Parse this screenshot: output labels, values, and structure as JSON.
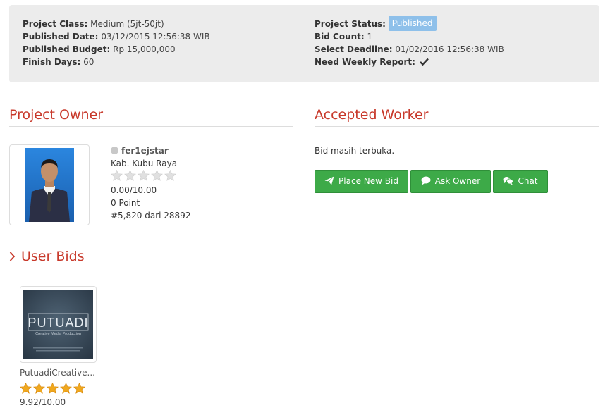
{
  "project_info": {
    "left": [
      {
        "label": "Project Class:",
        "value": "Medium (5jt-50jt)"
      },
      {
        "label": "Published Date:",
        "value": "03/12/2015 12:56:38 WIB"
      },
      {
        "label": "Published Budget:",
        "value": "Rp 15,000,000"
      },
      {
        "label": "Finish Days:",
        "value": "60"
      }
    ],
    "right": [
      {
        "label": "Project Status:",
        "badge": "Published"
      },
      {
        "label": "Bid Count:",
        "value": "1"
      },
      {
        "label": "Select Deadline:",
        "value": "01/02/2016 12:56:38 WIB"
      },
      {
        "label": "Need Weekly Report:",
        "icon": "check-icon"
      }
    ]
  },
  "owner_section": {
    "title": "Project Owner",
    "username": "fer1ejstar",
    "location": "Kab. Kubu Raya",
    "rating_stars": 0,
    "rating": "0.00/10.00",
    "points": "0 Point",
    "rank": "#5,820 dari 28892"
  },
  "worker_section": {
    "title": "Accepted Worker",
    "message": "Bid masih terbuka.",
    "buttons": {
      "place_bid": "Place New Bid",
      "ask_owner": "Ask Owner",
      "chat": "Chat"
    }
  },
  "bids_section": {
    "title": "User Bids",
    "bids": [
      {
        "name": "PutuadiCreative...",
        "rating_stars": 5,
        "rating": "9.92/10.00",
        "logo_text": "PUTUADI",
        "logo_subtext": "Creative Media Production"
      }
    ]
  },
  "colors": {
    "accent_red": "#c8392b",
    "button_green": "#3daa48",
    "badge_blue": "#8ec0ea",
    "star_gold": "#f0a81e",
    "star_empty": "#e0e0e0"
  }
}
